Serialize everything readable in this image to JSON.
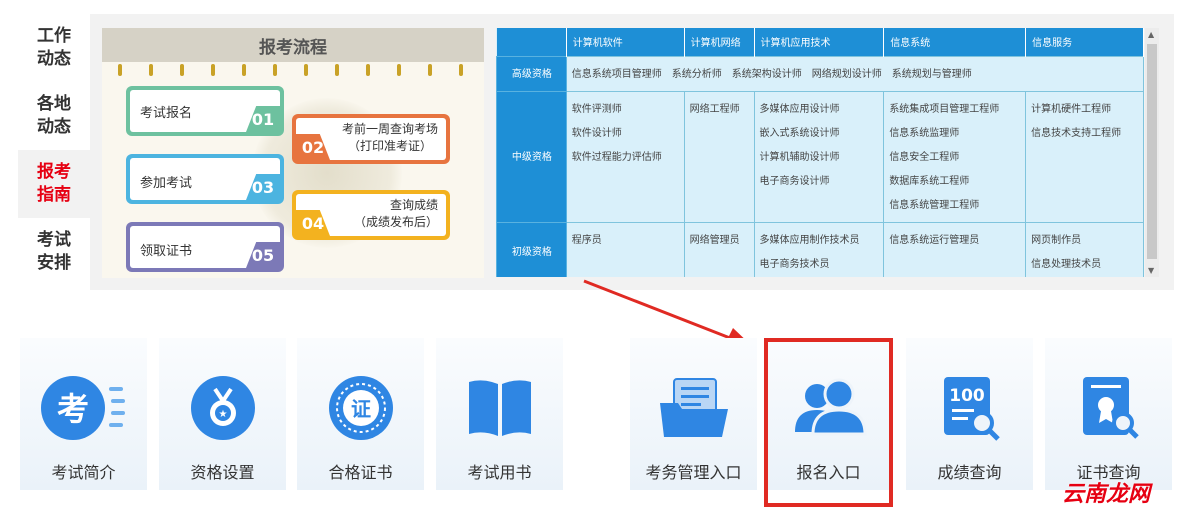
{
  "left_nav": [
    {
      "line1": "工作",
      "line2": "动态",
      "active": false
    },
    {
      "line1": "各地",
      "line2": "动态",
      "active": false
    },
    {
      "line1": "报考",
      "line2": "指南",
      "active": true
    },
    {
      "line1": "考试",
      "line2": "安排",
      "active": false
    }
  ],
  "flow": {
    "title": "报考流程",
    "steps": [
      {
        "text": "考试报名",
        "num": "01"
      },
      {
        "text": "考前一周查询考场\n（打印准考证）",
        "num": "02"
      },
      {
        "text": "参加考试",
        "num": "03"
      },
      {
        "text": "查询成绩\n（成绩发布后）",
        "num": "04"
      },
      {
        "text": "领取证书",
        "num": "05"
      }
    ]
  },
  "table": {
    "headers": [
      "",
      "计算机软件",
      "计算机网络",
      "计算机应用技术",
      "信息系统",
      "信息服务"
    ],
    "rows": [
      {
        "level": "高级资格",
        "merged": "信息系统项目管理师　系统分析师　系统架构设计师　网络规划设计师　系统规划与管理师"
      },
      {
        "level": "中级资格",
        "cells": [
          [
            "软件评测师",
            "软件设计师",
            "软件过程能力评估师"
          ],
          [
            "网络工程师"
          ],
          [
            "多媒体应用设计师",
            "嵌入式系统设计师",
            "计算机辅助设计师",
            "电子商务设计师"
          ],
          [
            "系统集成项目管理工程师",
            "信息系统监理师",
            "信息安全工程师",
            "数据库系统工程师",
            "信息系统管理工程师"
          ],
          [
            "计算机硬件工程师",
            "信息技术支持工程师"
          ]
        ]
      },
      {
        "level": "初级资格",
        "cells": [
          [
            "程序员"
          ],
          [
            "网络管理员"
          ],
          [
            "多媒体应用制作技术员",
            "电子商务技术员"
          ],
          [
            "信息系统运行管理员"
          ],
          [
            "网页制作员",
            "信息处理技术员"
          ]
        ]
      }
    ]
  },
  "tiles": [
    {
      "label": "考试简介",
      "icon": "exam-intro-icon"
    },
    {
      "label": "资格设置",
      "icon": "medal-icon"
    },
    {
      "label": "合格证书",
      "icon": "certificate-seal-icon"
    },
    {
      "label": "考试用书",
      "icon": "book-icon"
    },
    {
      "label": "考务管理入口",
      "icon": "folder-documents-icon"
    },
    {
      "label": "报名入口",
      "icon": "users-icon"
    },
    {
      "label": "成绩查询",
      "icon": "score-search-icon"
    },
    {
      "label": "证书查询",
      "icon": "certificate-search-icon"
    }
  ],
  "watermark": {
    "part1": "云南",
    "part2": "龙网"
  },
  "colors": {
    "accent": "#1e8fd6",
    "active_nav": "#e60012",
    "highlight": "#e02a23"
  }
}
